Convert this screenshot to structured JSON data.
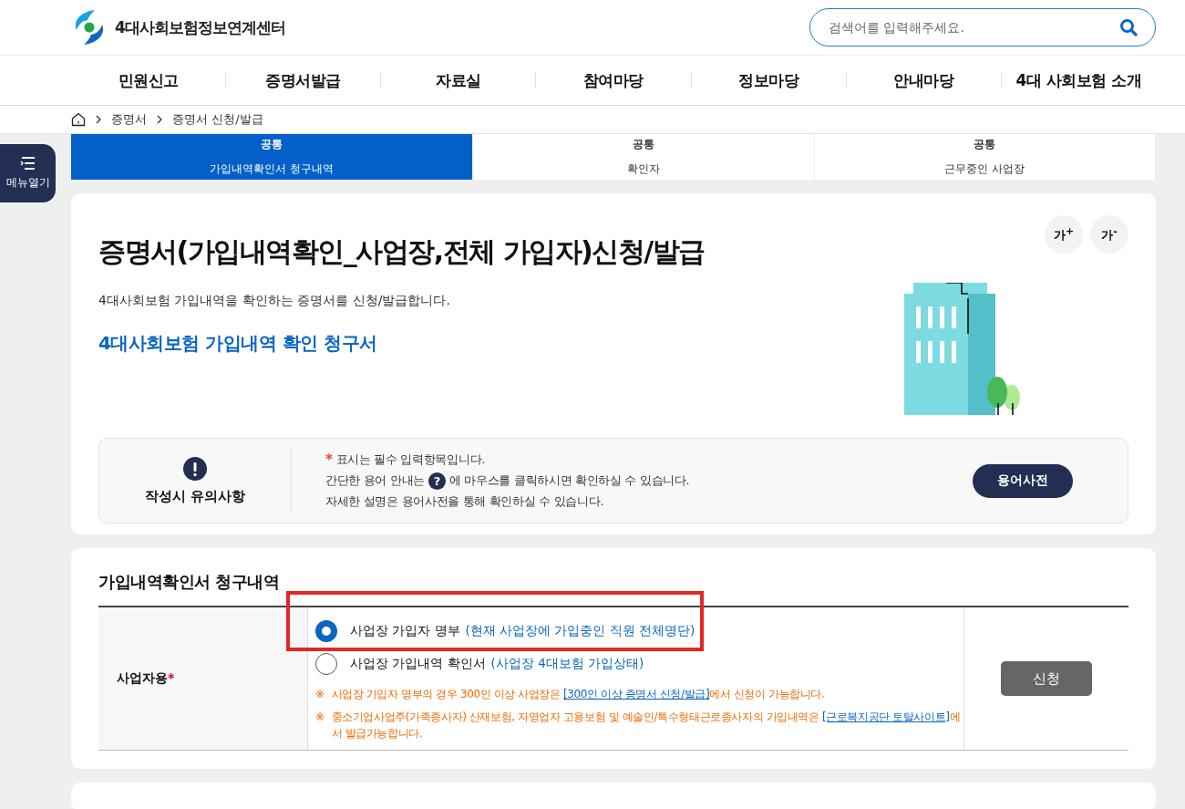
{
  "header": {
    "logo_text": "4대사회보험정보연계센터",
    "search": {
      "placeholder": "검색어를 입력해주세요."
    }
  },
  "nav": [
    "민원신고",
    "증명서발급",
    "자료실",
    "참여마당",
    "정보마당",
    "안내마당",
    "4대 사회보험 소개"
  ],
  "breadcrumb": [
    "증명서",
    "증명서 신청/발급"
  ],
  "menu_button": "메뉴열기",
  "tabs": [
    {
      "category": "공통",
      "label": "가입내역확인서 청구내역",
      "selected": true
    },
    {
      "category": "공통",
      "label": "확인자",
      "selected": false
    },
    {
      "category": "공통",
      "label": "근무중인 사업장",
      "selected": false
    }
  ],
  "font_buttons": [
    "가$^{+}$",
    "가$^{-}$"
  ],
  "page": {
    "title": "증명서(가입내역확인_사업장,전체 가입자)신청/발급",
    "description": "4대사회보험 가입내역을 확인하는 증명서를 신청/발급합니다.",
    "link": "4대사회보험 가입내역 확인 청구서"
  },
  "notice": {
    "heading": "작성시 유의사항",
    "lines": [
      {
        "kind": "required",
        "mark": "*",
        "text": "표시는 필수 입력항목입니다."
      },
      {
        "kind": "help",
        "before": "간단한 용어 안내는",
        "icon": "?",
        "after": "에 마우스를 클릭하시면 확인하실 수 있습니다."
      },
      {
        "kind": "plain",
        "text": "자세한 설명은 용어사전을 통해 확인하실 수 있습니다."
      }
    ],
    "button": "용어사전"
  },
  "section": {
    "title": "가입내역확인서 청구내역",
    "row_label": "사업자용",
    "required_mark": "*",
    "options": [
      {
        "label": "사업장 가입자 명부",
        "detail": "(현재 사업장에 가입중인 직원 전체명단)",
        "selected": true,
        "highlighted": true
      },
      {
        "label": "사업장 가입내역 확인서",
        "detail": "(사업장 4대보험 가입상태)",
        "selected": false,
        "highlighted": false
      }
    ],
    "notes": [
      {
        "mark": "※",
        "before": "사업장 가입자 명부의 경우 300인 이상 사업장은",
        "link": "[300인 이상 증명서 신청/발급]",
        "after": "에서 신청이 가능합니다."
      },
      {
        "mark": "※",
        "before": "중소기업사업주(가족종사자) 산재보험, 자영업자 고용보험 및 예술인/특수형태근로종사자의 가입내역은",
        "link": "[근로복지공단 토탈사이트]",
        "after": "에서 발급가능합니다."
      }
    ],
    "button": "신청"
  }
}
